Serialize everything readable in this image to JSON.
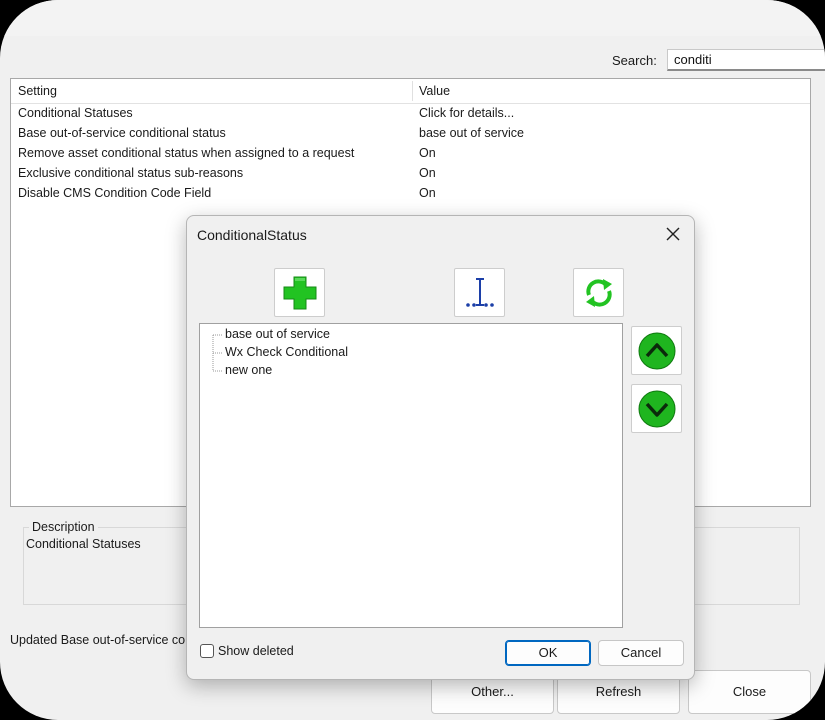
{
  "search": {
    "label": "Search:",
    "value": "conditi"
  },
  "grid": {
    "columns": {
      "setting": "Setting",
      "value": "Value"
    },
    "rows": [
      {
        "setting": "Conditional Statuses",
        "value": "Click for details..."
      },
      {
        "setting": "Base out-of-service conditional status",
        "value": "base out of service"
      },
      {
        "setting": "Remove asset conditional status when assigned to a request",
        "value": "On"
      },
      {
        "setting": "Exclusive conditional status sub-reasons",
        "value": "On"
      },
      {
        "setting": "Disable CMS Condition Code Field",
        "value": "On"
      }
    ]
  },
  "description": {
    "legend": "Description",
    "text": "Conditional Statuses"
  },
  "status_message": "Updated Base out-of-service co",
  "footer": {
    "other": "Other...",
    "refresh": "Refresh",
    "close": "Close"
  },
  "dialog": {
    "title": "ConditionalStatus",
    "toolbar_icons": [
      "plus-icon",
      "text-cursor-icon",
      "refresh-icon"
    ],
    "tree_items": [
      "base out of service",
      "Wx Check Conditional",
      "new one"
    ],
    "show_deleted": {
      "label": "Show deleted",
      "checked": false
    },
    "ok": "OK",
    "cancel": "Cancel"
  },
  "colors": {
    "accent_blue": "#0067c0",
    "add_green": "#22c322",
    "arrow_green": "#1fb51f",
    "cursor_blue": "#1c3fa8"
  }
}
